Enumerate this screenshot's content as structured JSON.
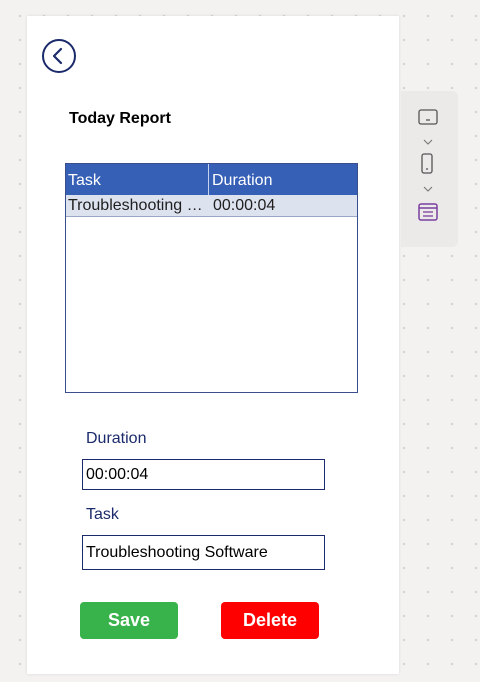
{
  "screen": {
    "title": "Today Report"
  },
  "gallery": {
    "columns": [
      "Task",
      "Duration"
    ],
    "rows": [
      {
        "task": "Troubleshooting Software",
        "duration": "00:00:04"
      }
    ]
  },
  "form": {
    "duration_label": "Duration",
    "duration_value": "00:00:04",
    "task_label": "Task",
    "task_value": "Troubleshooting Software"
  },
  "actions": {
    "save_label": "Save",
    "delete_label": "Delete"
  },
  "side_panel": {
    "items": [
      "tablet-layout-icon",
      "phone-layout-icon",
      "form-layout-icon"
    ]
  },
  "colors": {
    "accent_navy": "#1b2a6b",
    "header_blue": "#3560b6",
    "row_selected": "#dde2ef",
    "save_green": "#38b24a",
    "delete_red": "#ff0000",
    "form_icon_purple": "#7a3fa0"
  }
}
